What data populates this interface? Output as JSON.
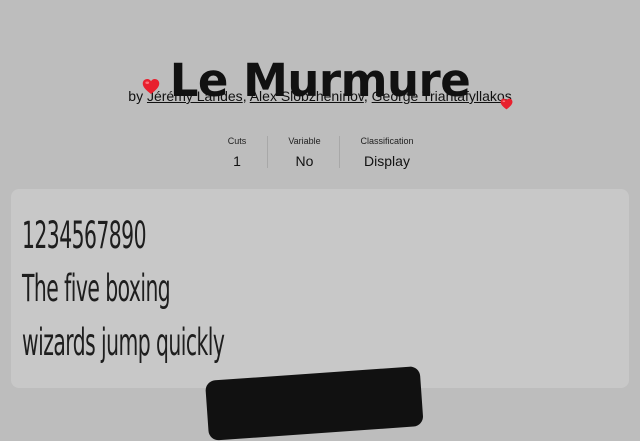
{
  "font": {
    "name": "Le Murmure",
    "byline_prefix": "by",
    "authors": [
      "Jérémy Landes",
      "Alex Slobzheninov",
      "George Triantafyllakos"
    ],
    "separator": ","
  },
  "stats": {
    "cuts": {
      "label": "Cuts",
      "value": "1"
    },
    "variable": {
      "label": "Variable",
      "value": "No"
    },
    "classification": {
      "label": "Classification",
      "value": "Display"
    }
  },
  "specimen": {
    "lines": [
      "1234567890",
      "The five boxing",
      "wizards jump quickly"
    ]
  },
  "icons": {
    "decoration": "heart-icon"
  },
  "colors": {
    "page_background": "#bdbdbd",
    "specimen_background": "#c8c8c8",
    "text": "#111111",
    "heart": "#e8202e",
    "card": "#111111"
  }
}
